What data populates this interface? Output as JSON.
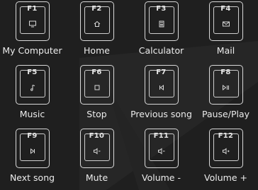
{
  "keys": [
    {
      "fn": "F1",
      "label": "My Computer",
      "icon": "monitor-icon"
    },
    {
      "fn": "F2",
      "label": "Home",
      "icon": "home-icon"
    },
    {
      "fn": "F3",
      "label": "Calculator",
      "icon": "calculator-icon"
    },
    {
      "fn": "F4",
      "label": "Mail",
      "icon": "mail-icon"
    },
    {
      "fn": "F5",
      "label": "Music",
      "icon": "music-note-icon"
    },
    {
      "fn": "F6",
      "label": "Stop",
      "icon": "stop-icon"
    },
    {
      "fn": "F7",
      "label": "Previous song",
      "icon": "previous-track-icon"
    },
    {
      "fn": "F8",
      "label": "Pause/Play",
      "icon": "play-pause-icon"
    },
    {
      "fn": "F9",
      "label": "Next song",
      "icon": "next-track-icon"
    },
    {
      "fn": "F10",
      "label": "Mute",
      "icon": "mute-icon"
    },
    {
      "fn": "F11",
      "label": "Volume -",
      "icon": "volume-down-icon"
    },
    {
      "fn": "F12",
      "label": "Volume +",
      "icon": "volume-up-icon"
    }
  ],
  "colors": {
    "background": "#1f1f1f",
    "outline": "#d9d9d9",
    "text": "#ececec"
  }
}
